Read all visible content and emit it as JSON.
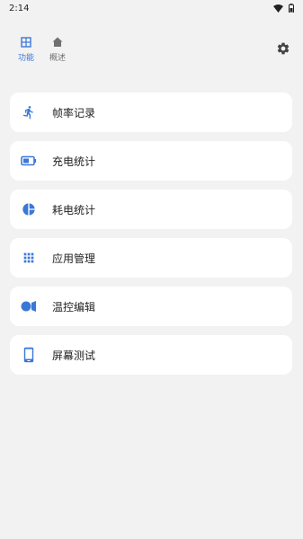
{
  "status_bar": {
    "time": "2:14"
  },
  "top_nav": {
    "tabs": [
      {
        "label": "功能",
        "icon": "grid-icon",
        "active": true
      },
      {
        "label": "概述",
        "icon": "home-icon",
        "active": false
      }
    ],
    "settings_icon": "gear-icon"
  },
  "menu": {
    "items": [
      {
        "label": "帧率记录",
        "icon": "running-person-icon"
      },
      {
        "label": "充电统计",
        "icon": "battery-icon"
      },
      {
        "label": "耗电统计",
        "icon": "pie-chart-icon"
      },
      {
        "label": "应用管理",
        "icon": "app-grid-icon"
      },
      {
        "label": "温控编辑",
        "icon": "video-camera-icon"
      },
      {
        "label": "屏幕测试",
        "icon": "phone-icon"
      }
    ]
  },
  "colors": {
    "accent": "#3a78d8",
    "background": "#f2f2f2",
    "card": "#ffffff"
  }
}
